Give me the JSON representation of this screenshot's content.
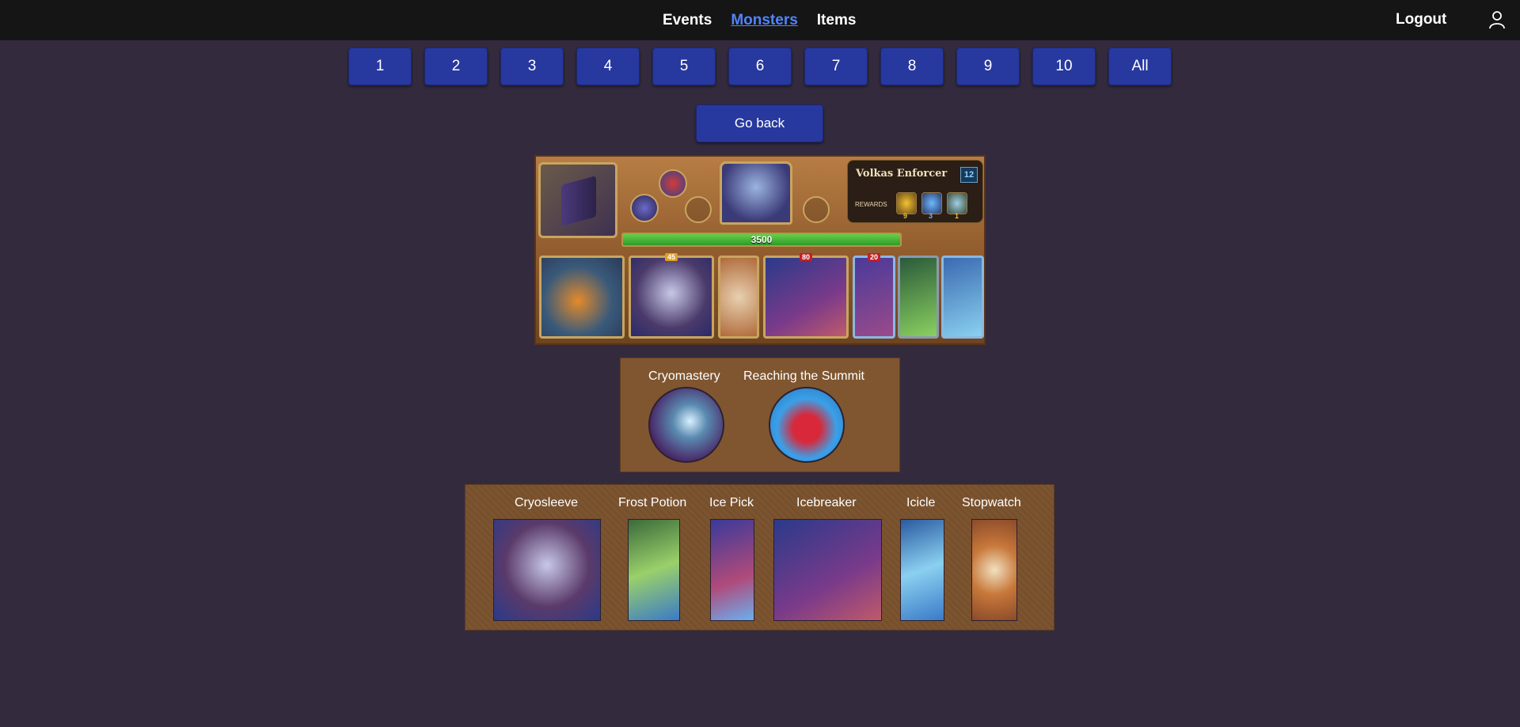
{
  "nav": {
    "links": [
      "Events",
      "Monsters",
      "Items"
    ],
    "active": "Monsters",
    "logout": "Logout",
    "user_icon": "user-icon"
  },
  "pagination": [
    "1",
    "2",
    "3",
    "4",
    "5",
    "6",
    "7",
    "8",
    "9",
    "10",
    "All"
  ],
  "go_back": "Go back",
  "monster": {
    "name": "Volkas Enforcer",
    "level": "12",
    "rewards_label": "REWARDS",
    "rewards": [
      {
        "icon": "gold-coins-icon",
        "count": "9",
        "color": "#f2c232"
      },
      {
        "icon": "experience-gem-icon",
        "count": "3",
        "color": "#6fb8ff"
      },
      {
        "icon": "item-card-icon",
        "count": "1",
        "color": "#f2c232"
      }
    ],
    "health": "3500",
    "card_badges": {
      "cryosleeve": "45",
      "icebreaker": "80",
      "ice_pick": "20"
    }
  },
  "skills": [
    {
      "name": "Cryomastery",
      "icon": "cryomastery-icon"
    },
    {
      "name": "Reaching the Summit",
      "icon": "flexed-arm-snowflake-icon"
    }
  ],
  "items": [
    {
      "name": "Cryosleeve",
      "icon": "cryosleeve-armor-icon"
    },
    {
      "name": "Frost Potion",
      "icon": "frost-potion-icon"
    },
    {
      "name": "Ice Pick",
      "icon": "ice-pick-icon"
    },
    {
      "name": "Icebreaker",
      "icon": "icebreaker-scythe-icon"
    },
    {
      "name": "Icicle",
      "icon": "icicle-icon"
    },
    {
      "name": "Stopwatch",
      "icon": "stopwatch-icon"
    }
  ]
}
